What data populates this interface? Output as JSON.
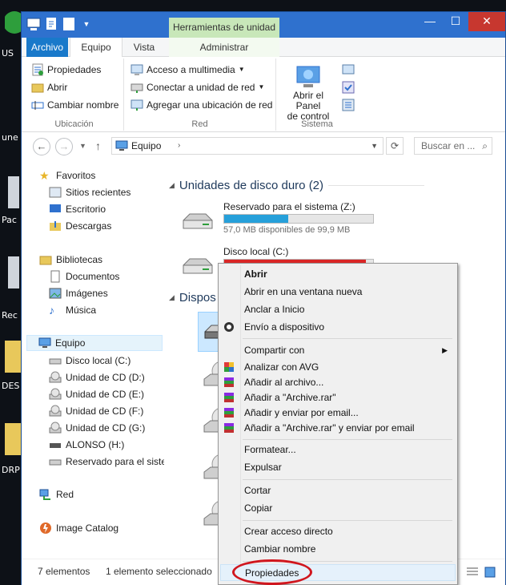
{
  "desktop": {
    "labels": [
      "US",
      "une",
      "Pac",
      "Rec",
      "DES",
      "DRP"
    ]
  },
  "window": {
    "contextual_tab_title": "Herramientas de unidad",
    "tabs": [
      {
        "label": "Archivo"
      },
      {
        "label": "Equipo"
      },
      {
        "label": "Vista"
      },
      {
        "label": "Administrar"
      }
    ],
    "controls": {
      "minimize": "—",
      "maximize": "☐",
      "close": "✕"
    }
  },
  "ribbon": {
    "groups": [
      {
        "label": "Ubicación",
        "items": [
          "Propiedades",
          "Abrir",
          "Cambiar nombre"
        ]
      },
      {
        "label": "Red",
        "items": [
          "Acceso a multimedia",
          "Conectar a unidad de red",
          "Agregar una ubicación de red"
        ]
      },
      {
        "label": "Sistema",
        "big_button": "Abrir el Panel de control",
        "big_button_line1": "Abrir el Panel",
        "big_button_line2": "de control"
      }
    ]
  },
  "address": {
    "crumb": "Equipo",
    "search_placeholder": "Buscar en ..."
  },
  "navpane": {
    "items": [
      {
        "label": "Favoritos",
        "icon": "star-icon"
      },
      {
        "label": "Sitios recientes",
        "icon": "recent-icon"
      },
      {
        "label": "Escritorio",
        "icon": "desktop-icon"
      },
      {
        "label": "Descargas",
        "icon": "download-icon"
      },
      {
        "label": "Bibliotecas",
        "icon": "library-icon"
      },
      {
        "label": "Documentos",
        "icon": "document-icon"
      },
      {
        "label": "Imágenes",
        "icon": "image-icon"
      },
      {
        "label": "Música",
        "icon": "music-icon"
      },
      {
        "label": "Equipo",
        "icon": "computer-icon"
      },
      {
        "label": "Disco local (C:)",
        "icon": "drive-icon"
      },
      {
        "label": "Unidad de CD (D:)",
        "icon": "cd-icon"
      },
      {
        "label": "Unidad de CD (E:)",
        "icon": "cd-icon"
      },
      {
        "label": "Unidad de CD (F:)",
        "icon": "cd-icon"
      },
      {
        "label": "Unidad de CD (G:)",
        "icon": "cd-icon"
      },
      {
        "label": "ALONSO (H:)",
        "icon": "usb-icon"
      },
      {
        "label": "Reservado para el sister",
        "icon": "drive-icon"
      },
      {
        "label": "Red",
        "icon": "network-icon"
      },
      {
        "label": "Image Catalog",
        "icon": "catalog-icon"
      }
    ]
  },
  "main": {
    "section_hard_drives": "Unidades de disco duro (2)",
    "section_devices": "Dispos",
    "drives": [
      {
        "name": "Reservado para el sistema (Z:)",
        "size": "57,0 MB disponibles de 99,9 MB",
        "fill": 0.43,
        "color": "#26a0da"
      },
      {
        "name": "Disco local (C:)",
        "size": "",
        "fill": 0.95,
        "color": "#da2626"
      }
    ]
  },
  "status": {
    "count": "7 elementos",
    "selected": "1 elemento seleccionado"
  },
  "context_menu": {
    "items": [
      {
        "label": "Abrir",
        "bold": true
      },
      {
        "label": "Abrir en una ventana nueva"
      },
      {
        "label": "Anclar a Inicio"
      },
      {
        "label": "Envío a dispositivo",
        "icon": "device-icon"
      },
      {
        "label": "Compartir con",
        "submenu": true
      },
      {
        "label": "Analizar con AVG",
        "icon": "avg-icon"
      },
      {
        "label": "Añadir al archivo...",
        "icon": "winrar-icon"
      },
      {
        "label": "Añadir a \"Archive.rar\"",
        "icon": "winrar-icon"
      },
      {
        "label": "Añadir y enviar por email...",
        "icon": "winrar-icon"
      },
      {
        "label": "Añadir a \"Archive.rar\" y enviar por email",
        "icon": "winrar-icon"
      },
      {
        "label": "Formatear..."
      },
      {
        "label": "Expulsar"
      },
      {
        "label": "Cortar"
      },
      {
        "label": "Copiar"
      },
      {
        "label": "Crear acceso directo"
      },
      {
        "label": "Cambiar nombre"
      },
      {
        "label": "Propiedades",
        "highlighted": true
      }
    ]
  }
}
